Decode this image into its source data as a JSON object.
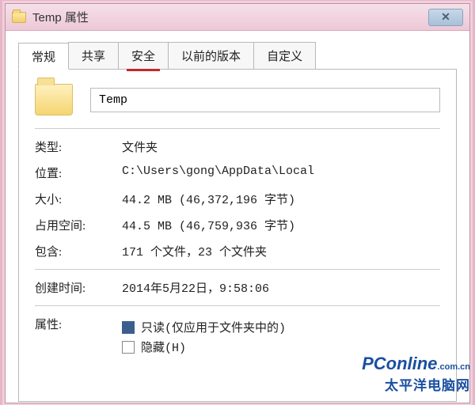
{
  "window": {
    "title": "Temp 属性"
  },
  "tabs": {
    "general": "常规",
    "share": "共享",
    "security": "安全",
    "previous": "以前的版本",
    "custom": "自定义"
  },
  "folder": {
    "name": "Temp"
  },
  "labels": {
    "type": "类型:",
    "location": "位置:",
    "size": "大小:",
    "ondisk": "占用空间:",
    "contains": "包含:",
    "created": "创建时间:",
    "attributes": "属性:"
  },
  "values": {
    "type": "文件夹",
    "location": "C:\\Users\\gong\\AppData\\Local",
    "size": "44.2 MB (46,372,196 字节)",
    "ondisk": "44.5 MB (46,759,936 字节)",
    "contains": "171 个文件，23 个文件夹",
    "created": "2014年5月22日，9:58:06"
  },
  "attrs": {
    "readonly_label": "只读(仅应用于文件夹中的)",
    "hidden_label": "隐藏(H)"
  },
  "watermark": {
    "brand": "PConline",
    "suffix": ".com.cn",
    "cn": "太平洋电脑网"
  }
}
